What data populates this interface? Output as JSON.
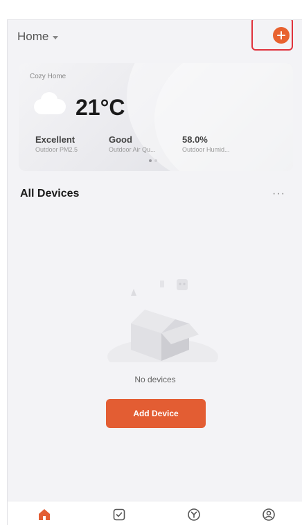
{
  "header": {
    "home_label": "Home"
  },
  "weather": {
    "home_name": "Cozy Home",
    "temperature": "21°C",
    "metrics": [
      {
        "value": "Excellent",
        "label": "Outdoor PM2.5"
      },
      {
        "value": "Good",
        "label": "Outdoor Air Qu..."
      },
      {
        "value": "58.0%",
        "label": "Outdoor Humid..."
      }
    ]
  },
  "devices": {
    "section_title": "All Devices",
    "more_label": "···",
    "empty_text": "No devices",
    "add_button_label": "Add Device"
  },
  "tabs": [
    {
      "icon": "home-icon",
      "active": true
    },
    {
      "icon": "scene-check-icon",
      "active": false
    },
    {
      "icon": "smart-icon",
      "active": false
    },
    {
      "icon": "profile-icon",
      "active": false
    }
  ],
  "colors": {
    "accent": "#e35d33",
    "highlight_border": "#e0323c"
  }
}
